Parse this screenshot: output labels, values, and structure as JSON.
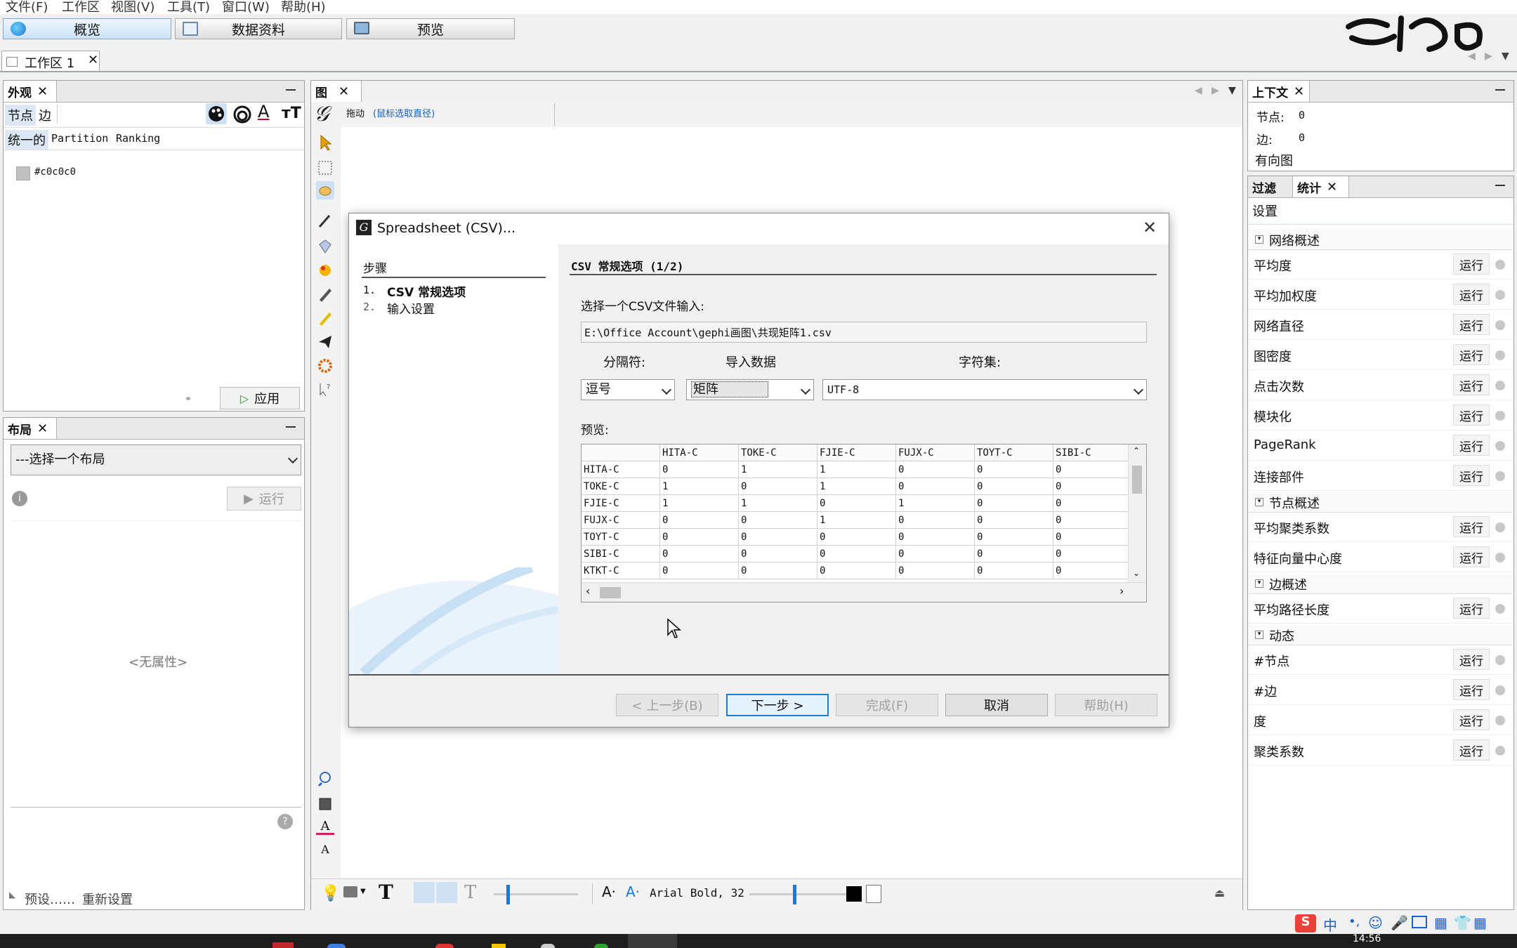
{
  "menu": [
    "文件(F)",
    "工作区",
    "视图(V)",
    "工具(T)",
    "窗口(W)",
    "帮助(H)"
  ],
  "modes": [
    "概览",
    "数据资料",
    "预览"
  ],
  "workspace_tab": "工作区 1",
  "appearance": {
    "tab": "外观",
    "sub_tabs": [
      "节点",
      "边"
    ],
    "modes": [
      "统一的",
      "Partition",
      "Ranking"
    ],
    "color_value": "#c0c0c0",
    "apply": "应用"
  },
  "layout": {
    "tab": "布局",
    "select": "---选择一个布局",
    "run": "运行",
    "empty": "<无属性>",
    "presets": "预设……",
    "reset": "重新设置"
  },
  "graph": {
    "tab": "图",
    "drag_label": "拖动",
    "drag_hint": "(鼠标选取直径)",
    "font_label": "Arial Bold, 32"
  },
  "context": {
    "tab": "上下文",
    "nodes_label": "节点:",
    "nodes_value": "0",
    "edges_label": "边:",
    "edges_value": "0",
    "graph_type": "有向图"
  },
  "stats": {
    "tab_filter": "过滤",
    "tab_stats": "统计",
    "settings": "设置",
    "run_label": "运行",
    "sections": [
      {
        "title": "网络概述",
        "items": [
          "平均度",
          "平均加权度",
          "网络直径",
          "图密度",
          "点击次数",
          "模块化",
          "PageRank",
          "连接部件"
        ]
      },
      {
        "title": "节点概述",
        "items": [
          "平均聚类系数",
          "特征向量中心度"
        ]
      },
      {
        "title": "边概述",
        "items": [
          "平均路径长度"
        ]
      },
      {
        "title": "动态",
        "items": [
          "#节点",
          "#边",
          "度",
          "聚类系数"
        ]
      }
    ]
  },
  "dialog": {
    "title": "Spreadsheet (CSV)...",
    "steps_title": "步骤",
    "steps": [
      {
        "num": "1.",
        "label": "CSV 常规选项"
      },
      {
        "num": "2.",
        "label": "输入设置"
      }
    ],
    "section_title": "CSV 常规选项 (1/2)",
    "file_label": "选择一个CSV文件输入:",
    "file_path": "E:\\Office Account\\gephi画图\\共现矩阵1.csv",
    "separator_label": "分隔符:",
    "separator_value": "逗号",
    "import_label": "导入数据",
    "import_value": "矩阵",
    "charset_label": "字符集:",
    "charset_value": "UTF-8",
    "preview_label": "预览:",
    "table": {
      "columns": [
        "HITA-C",
        "TOKE-C",
        "FJIE-C",
        "FUJX-C",
        "TOYT-C",
        "SIBI-C"
      ],
      "rows": [
        {
          "name": "HITA-C",
          "values": [
            "0",
            "1",
            "1",
            "0",
            "0",
            "0"
          ]
        },
        {
          "name": "TOKE-C",
          "values": [
            "1",
            "0",
            "1",
            "0",
            "0",
            "0"
          ]
        },
        {
          "name": "FJIE-C",
          "values": [
            "1",
            "1",
            "0",
            "1",
            "0",
            "0"
          ]
        },
        {
          "name": "FUJX-C",
          "values": [
            "0",
            "0",
            "1",
            "0",
            "0",
            "0"
          ]
        },
        {
          "name": "TOYT-C",
          "values": [
            "0",
            "0",
            "0",
            "0",
            "0",
            "0"
          ]
        },
        {
          "name": "SIBI-C",
          "values": [
            "0",
            "0",
            "0",
            "0",
            "0",
            "0"
          ]
        },
        {
          "name": "KTKT-C",
          "values": [
            "0",
            "0",
            "0",
            "0",
            "0",
            "0"
          ]
        }
      ]
    },
    "buttons": {
      "back": "< 上一步(B)",
      "next": "下一步 >",
      "finish": "完成(F)",
      "cancel": "取消",
      "help": "帮助(H)"
    }
  },
  "tray": {
    "ime": "中",
    "time": "14:56"
  },
  "colors": {
    "accent": "#1e7bd4",
    "link": "#1a5fb4",
    "node_color": "#c0c0c0"
  }
}
